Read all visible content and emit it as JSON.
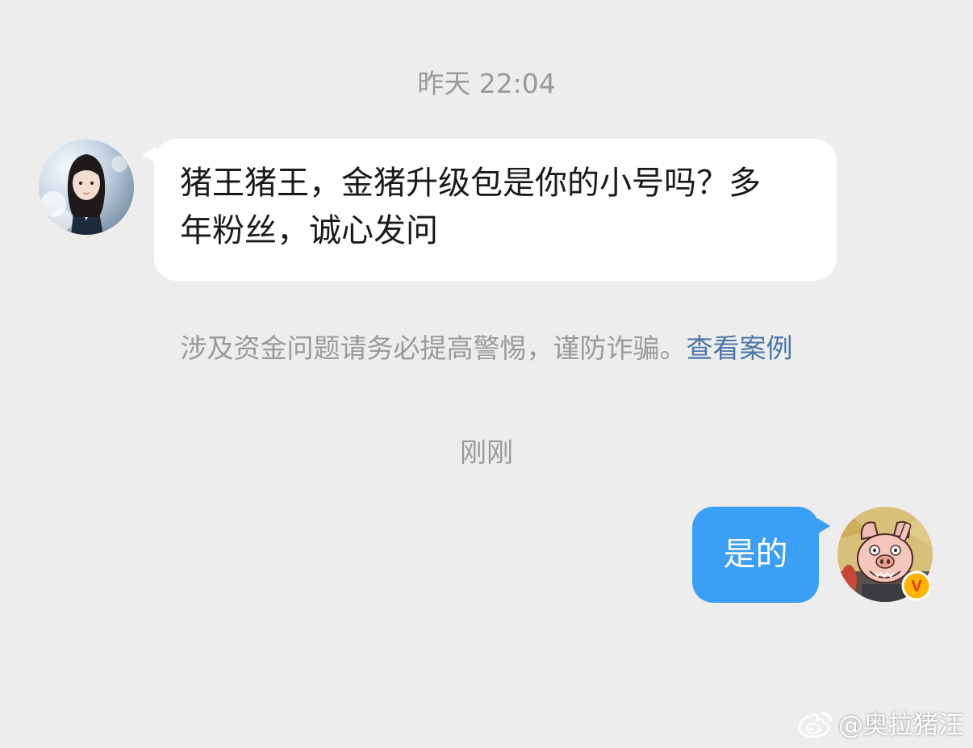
{
  "timestamps": {
    "first": "昨天 22:04",
    "second": "刚刚"
  },
  "messages": [
    {
      "side": "left",
      "text": "猪王猪王，金猪升级包是你的小号吗？多年粉丝，诚心发问"
    },
    {
      "side": "right",
      "text": "是的"
    }
  ],
  "notice": {
    "text": "涉及资金问题请务必提高警惕，谨防诈骗。",
    "link_label": "查看案例"
  },
  "avatars": {
    "left": "avatar-girl-photo",
    "right": "avatar-pig-cartoon",
    "right_badge": "V"
  },
  "watermark": {
    "text": "@奥拉猪汪",
    "icon": "weibo-logo"
  },
  "colors": {
    "background": "#ededed",
    "bubble_incoming": "#ffffff",
    "bubble_outgoing": "#3a9ff5",
    "link": "#4a76a8",
    "badge": "#ffb400"
  }
}
